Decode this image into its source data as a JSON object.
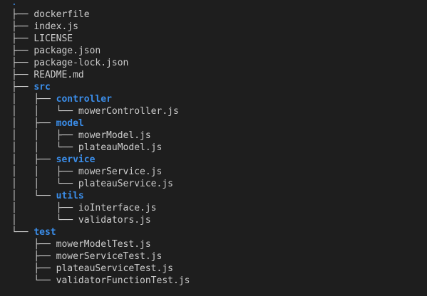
{
  "colors": {
    "background": "#1e1e1e",
    "text": "#cccccc",
    "directory": "#3b8eea"
  },
  "tree": [
    {
      "prefix": "",
      "name": ".",
      "type": "root"
    },
    {
      "prefix": "├── ",
      "name": "dockerfile",
      "type": "file"
    },
    {
      "prefix": "├── ",
      "name": "index.js",
      "type": "file"
    },
    {
      "prefix": "├── ",
      "name": "LICENSE",
      "type": "file"
    },
    {
      "prefix": "├── ",
      "name": "package.json",
      "type": "file"
    },
    {
      "prefix": "├── ",
      "name": "package-lock.json",
      "type": "file"
    },
    {
      "prefix": "├── ",
      "name": "README.md",
      "type": "file"
    },
    {
      "prefix": "├── ",
      "name": "src",
      "type": "dir"
    },
    {
      "prefix": "│   ├── ",
      "name": "controller",
      "type": "dir"
    },
    {
      "prefix": "│   │   └── ",
      "name": "mowerController.js",
      "type": "file"
    },
    {
      "prefix": "│   ├── ",
      "name": "model",
      "type": "dir"
    },
    {
      "prefix": "│   │   ├── ",
      "name": "mowerModel.js",
      "type": "file"
    },
    {
      "prefix": "│   │   └── ",
      "name": "plateauModel.js",
      "type": "file"
    },
    {
      "prefix": "│   ├── ",
      "name": "service",
      "type": "dir"
    },
    {
      "prefix": "│   │   ├── ",
      "name": "mowerService.js",
      "type": "file"
    },
    {
      "prefix": "│   │   └── ",
      "name": "plateauService.js",
      "type": "file"
    },
    {
      "prefix": "│   └── ",
      "name": "utils",
      "type": "dir"
    },
    {
      "prefix": "│       ├── ",
      "name": "ioInterface.js",
      "type": "file"
    },
    {
      "prefix": "│       └── ",
      "name": "validators.js",
      "type": "file"
    },
    {
      "prefix": "└── ",
      "name": "test",
      "type": "dir"
    },
    {
      "prefix": "    ├── ",
      "name": "mowerModelTest.js",
      "type": "file"
    },
    {
      "prefix": "    ├── ",
      "name": "mowerServiceTest.js",
      "type": "file"
    },
    {
      "prefix": "    ├── ",
      "name": "plateauServiceTest.js",
      "type": "file"
    },
    {
      "prefix": "    └── ",
      "name": "validatorFunctionTest.js",
      "type": "file"
    }
  ]
}
